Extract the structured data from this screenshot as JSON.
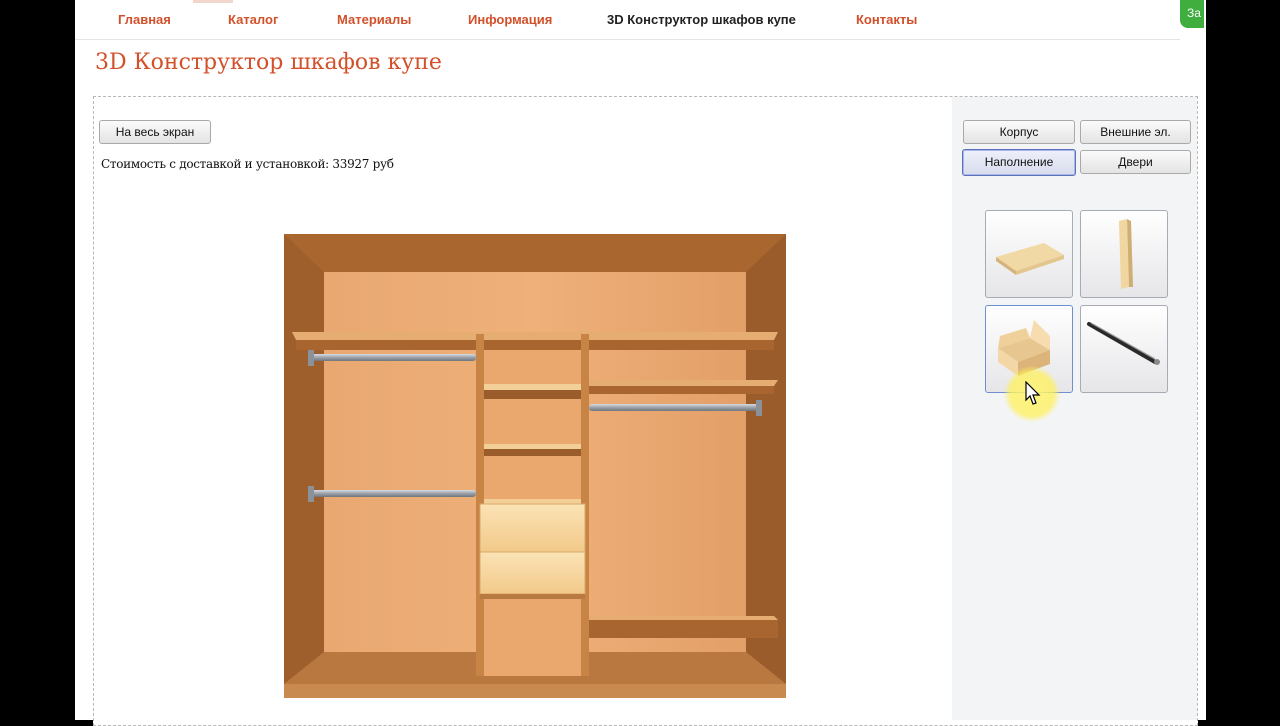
{
  "nav": {
    "items": [
      "Главная",
      "Каталог",
      "Материалы",
      "Информация",
      "3D Конструктор шкафов купе",
      "Контакты"
    ],
    "active_index": 4
  },
  "page_title": "3D Конструктор шкафов купе",
  "fullscreen_button": "На весь экран",
  "cost_text": "Стоимость с доставкой и установкой: 33927 руб",
  "panel_tabs": {
    "korpus": "Корпус",
    "external": "Внешние эл.",
    "filling": "Наполнение",
    "doors": "Двери",
    "selected": "Наполнение"
  },
  "badge_text": "За",
  "palette": {
    "accent": "#d2502a",
    "wood_back": "#e9a46a",
    "wood_frame": "#b36f38",
    "drawer": "#f5cf95"
  }
}
